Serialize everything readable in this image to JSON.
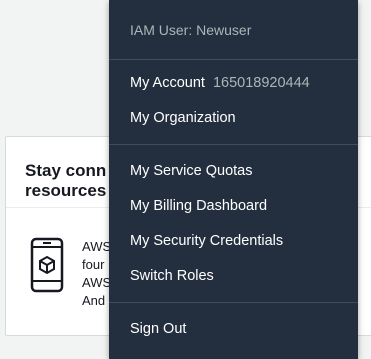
{
  "background_card": {
    "title": "Stay conn\nresources",
    "body": "AWS\nfour\nAWS\nAnd"
  },
  "account_menu": {
    "header": "IAM User: Newuser",
    "my_account": {
      "label": "My Account",
      "account_id": "165018920444"
    },
    "items_group1": [
      "My Organization"
    ],
    "items_group2": [
      "My Service Quotas",
      "My Billing Dashboard",
      "My Security Credentials",
      "Switch Roles"
    ],
    "sign_out": "Sign Out"
  },
  "colors": {
    "menu_bg": "#232f3e",
    "menu_text": "#ffffff",
    "menu_muted": "#aab7b8",
    "page_bg": "#f2f3f3"
  },
  "icons": {
    "device": "mobile-device-icon"
  }
}
